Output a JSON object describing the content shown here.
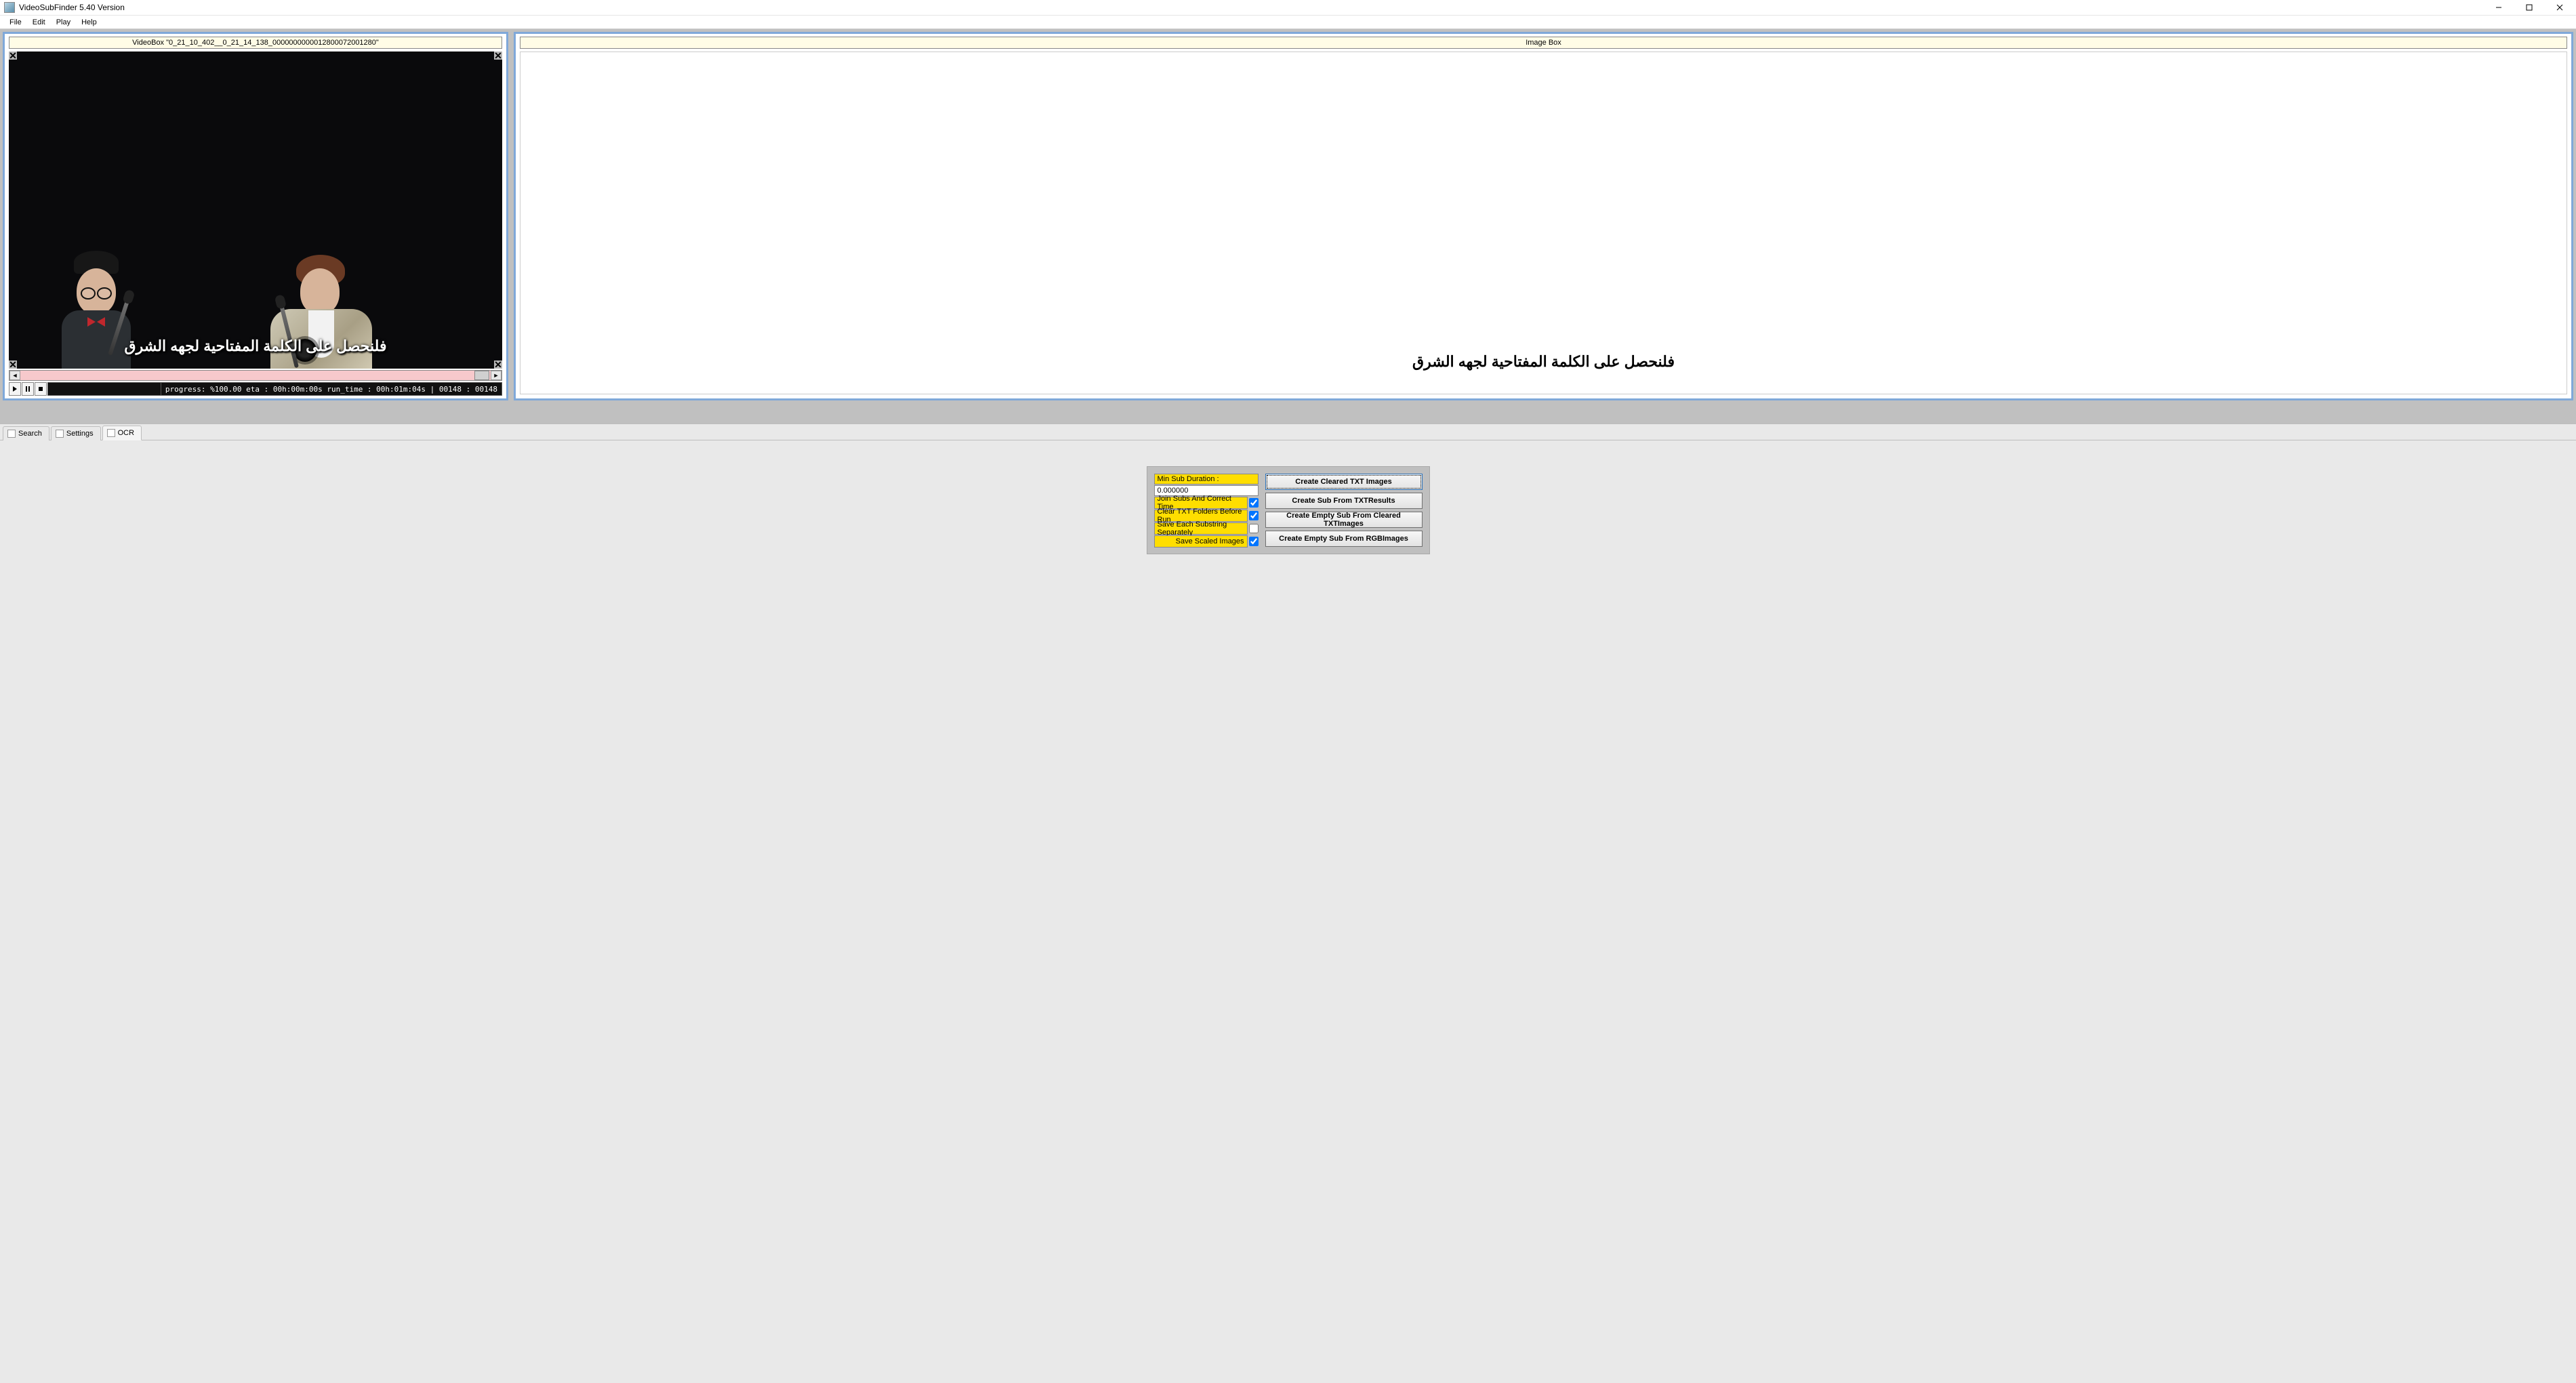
{
  "window": {
    "title": "VideoSubFinder 5.40 Version"
  },
  "menubar": [
    "File",
    "Edit",
    "Play",
    "Help"
  ],
  "video_panel": {
    "header": "VideoBox \"0_21_10_402__0_21_14_138_0000000000012800072001280\"",
    "subtitle": "فلنحصل على الكلمة المفتاحية لجهه الشرق",
    "status": "progress: %100.00 eta : 00h:00m:00s run_time : 00h:01m:04s   |   00148 : 00148"
  },
  "image_panel": {
    "header": "Image Box",
    "subtitle": "فلنحصل على الكلمة المفتاحية لجهه الشرق"
  },
  "tabs": {
    "items": [
      "Search",
      "Settings",
      "OCR"
    ],
    "active_index": 2
  },
  "ocr": {
    "min_sub_label": "Min Sub Duration :",
    "min_sub_value": "0.000000",
    "opts": [
      {
        "label": "Join Subs And Correct Time",
        "checked": true
      },
      {
        "label": "Clear TXT Folders Before Run",
        "checked": true
      },
      {
        "label": "Save Each Substring Separately",
        "checked": false
      },
      {
        "label": "Save Scaled Images",
        "checked": true
      }
    ],
    "buttons": [
      "Create Cleared TXT Images",
      "Create Sub From TXTResults",
      "Create Empty Sub From Cleared TXTImages",
      "Create Empty Sub From RGBImages"
    ]
  }
}
